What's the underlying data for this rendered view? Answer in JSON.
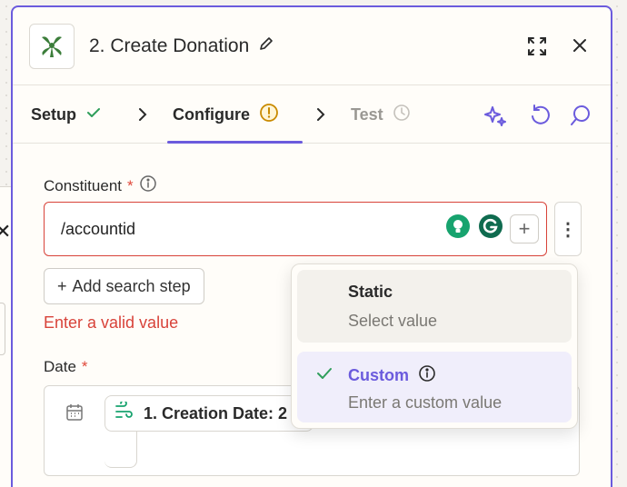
{
  "step": {
    "title": "2. Create Donation"
  },
  "tabs": [
    {
      "label": "Setup"
    },
    {
      "label": "Configure"
    },
    {
      "label": "Test"
    }
  ],
  "fields": {
    "constituent": {
      "label": "Constituent",
      "required_mark": "*",
      "value": "/accountid",
      "add_search_step": "Add search step",
      "error": "Enter a valid value"
    },
    "date": {
      "label": "Date",
      "required_mark": "*",
      "pill_text": "1. Creation Date: 2"
    }
  },
  "dropdown": {
    "options": [
      {
        "title": "Static",
        "description": "Select value"
      },
      {
        "title": "Custom",
        "description": "Enter a custom value",
        "selected": true
      }
    ]
  },
  "colors": {
    "accent": "#6b5bdd",
    "error": "#d8433a",
    "success": "#2f9e5b"
  }
}
